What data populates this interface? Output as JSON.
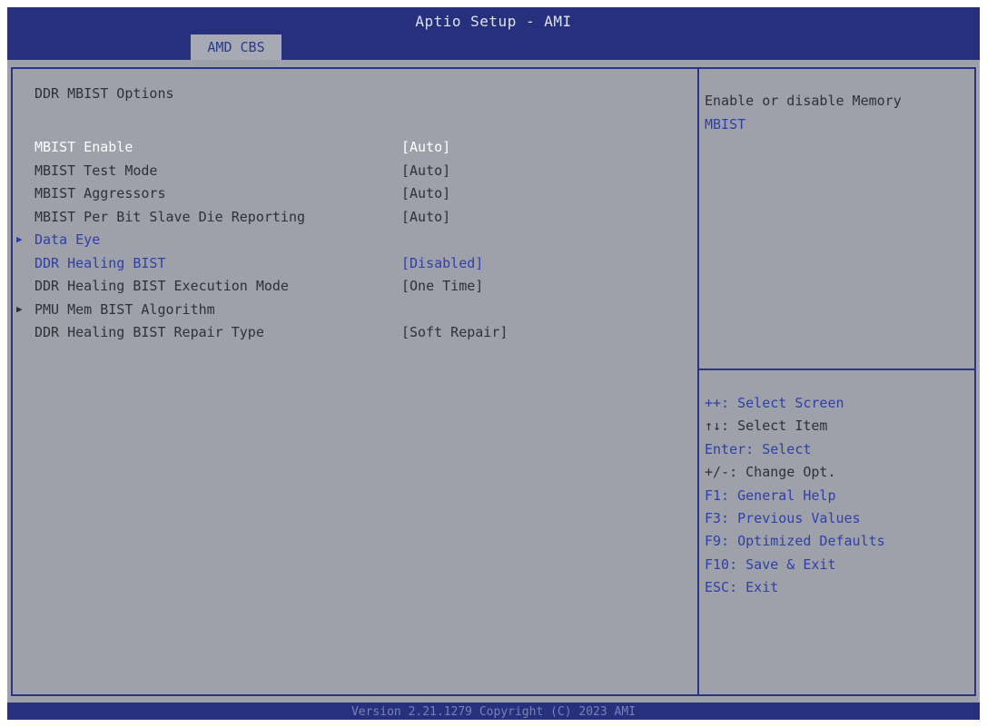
{
  "header": {
    "title": "Aptio Setup - AMI",
    "tab": "AMD CBS"
  },
  "main": {
    "section_title": "DDR MBIST Options",
    "rows": [
      {
        "label": "MBIST Enable",
        "value": "[Auto]"
      },
      {
        "label": "MBIST Test Mode",
        "value": "[Auto]"
      },
      {
        "label": "MBIST Aggressors",
        "value": "[Auto]"
      },
      {
        "label": "MBIST Per Bit Slave Die Reporting",
        "value": "[Auto]"
      },
      {
        "label": "Data Eye",
        "value": ""
      },
      {
        "label": "DDR Healing BIST",
        "value": "[Disabled]"
      },
      {
        "label": "DDR Healing BIST Execution Mode",
        "value": "[One Time]"
      },
      {
        "label": "PMU Mem BIST Algorithm",
        "value": ""
      },
      {
        "label": "DDR Healing BIST Repair Type",
        "value": "[Soft Repair]"
      }
    ],
    "submenu_arrow": "▶"
  },
  "help": {
    "line1": "Enable or disable Memory",
    "line2": "MBIST"
  },
  "keys": [
    {
      "key": "++:",
      "desc": "Select Screen"
    },
    {
      "key": "↑↓:",
      "desc": "Select Item"
    },
    {
      "key": "Enter:",
      "desc": "Select"
    },
    {
      "key": "+/-:",
      "desc": "Change Opt."
    },
    {
      "key": "F1:",
      "desc": "General Help"
    },
    {
      "key": "F3:",
      "desc": "Previous Values"
    },
    {
      "key": "F9:",
      "desc": "Optimized Defaults"
    },
    {
      "key": "F10:",
      "desc": "Save & Exit"
    },
    {
      "key": "ESC:",
      "desc": "Exit"
    }
  ],
  "footer": {
    "text": "Version 2.21.1279 Copyright (C) 2023 AMI"
  },
  "colors": {
    "header_bg": "#27307d",
    "panel_bg": "#9ea1a9",
    "highlight_text": "#ffffff",
    "link_text": "#2f3fa8"
  }
}
